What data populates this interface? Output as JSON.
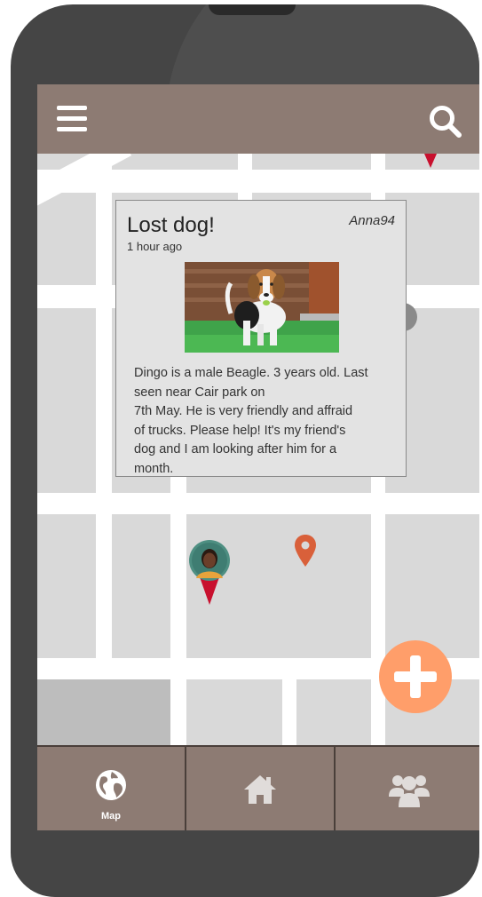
{
  "colors": {
    "bar": "#8d7b73",
    "fab": "#ff9e6a",
    "pin_red": "#c8102e",
    "pin_orange": "#d9603a"
  },
  "header": {
    "menu_icon": "hamburger-icon",
    "search_icon": "search-icon"
  },
  "post": {
    "title": "Lost dog!",
    "time": "1 hour ago",
    "user": "Anna94",
    "image_icon": "beagle-photo",
    "description_lines": [
      "Dingo is a male Beagle. 3 years old. Last",
      "seen near Cair park on",
      "7th May. He is very friendly and affraid",
      "of trucks. Please help! It's my friend's",
      "dog and I am looking after him for a",
      "month."
    ]
  },
  "fab": {
    "icon": "plus-icon"
  },
  "bottom_nav": {
    "items": [
      {
        "icon": "globe-icon",
        "label": "Map"
      },
      {
        "icon": "home-icon",
        "label": ""
      },
      {
        "icon": "group-icon",
        "label": ""
      }
    ]
  }
}
